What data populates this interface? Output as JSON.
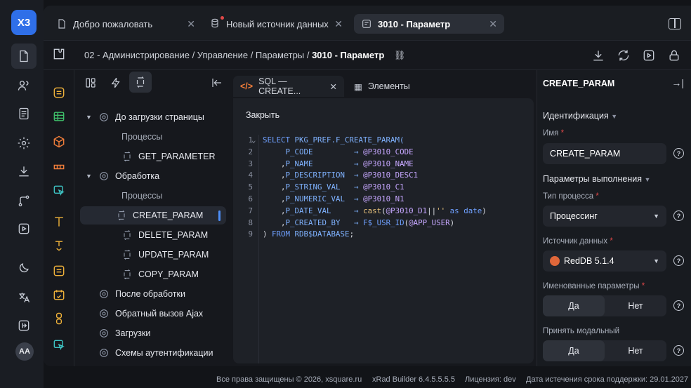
{
  "logo": "X3",
  "tabs": [
    {
      "label": "Добро пожаловать"
    },
    {
      "label": "Новый источник данных"
    },
    {
      "label": "3010 - Параметр"
    }
  ],
  "breadcrumb": {
    "path": "02 - Администрирование / Управление / Параметры / ",
    "current": "3010 - Параметр"
  },
  "tree": {
    "nodes": [
      {
        "label": "До загрузки страницы"
      },
      {
        "label": "Процессы"
      },
      {
        "label": "GET_PARAMETER"
      },
      {
        "label": "Обработка"
      },
      {
        "label": "Процессы"
      },
      {
        "label": "CREATE_PARAM"
      },
      {
        "label": "DELETE_PARAM"
      },
      {
        "label": "UPDATE_PARAM"
      },
      {
        "label": "COPY_PARAM"
      },
      {
        "label": "После обработки"
      },
      {
        "label": "Обратный вызов Ajax"
      },
      {
        "label": "Загрузки"
      },
      {
        "label": "Схемы аутентификации"
      }
    ]
  },
  "editor": {
    "tabs": [
      {
        "label": "SQL — CREATE..."
      },
      {
        "label": "Элементы"
      }
    ],
    "close_label": "Закрыть",
    "line_numbers": [
      "1",
      "2",
      "3",
      "4",
      "5",
      "6",
      "7",
      "8",
      "9"
    ]
  },
  "right": {
    "title": "CREATE_PARAM",
    "sec_ident": "Идентификация",
    "name_label": "Имя",
    "name_value": "CREATE_PARAM",
    "sec_exec": "Параметры выполнения",
    "proc_type_label": "Тип процесса",
    "proc_type_value": "Процессинг",
    "ds_label": "Источник данных",
    "ds_value": "RedDB 5.1.4",
    "named_params_label": "Именованные параметры",
    "modal_label": "Принять модальный",
    "yes": "Да",
    "no": "Нет"
  },
  "footer": {
    "copyright": "Все права защищены © 2026, xsquare.ru",
    "version": "xRad Builder 6.4.5.5.5.5",
    "license": "Лицензия: dev",
    "support": "Дата истечения срока поддержки: 29.01.2027"
  },
  "avatar": "AA"
}
